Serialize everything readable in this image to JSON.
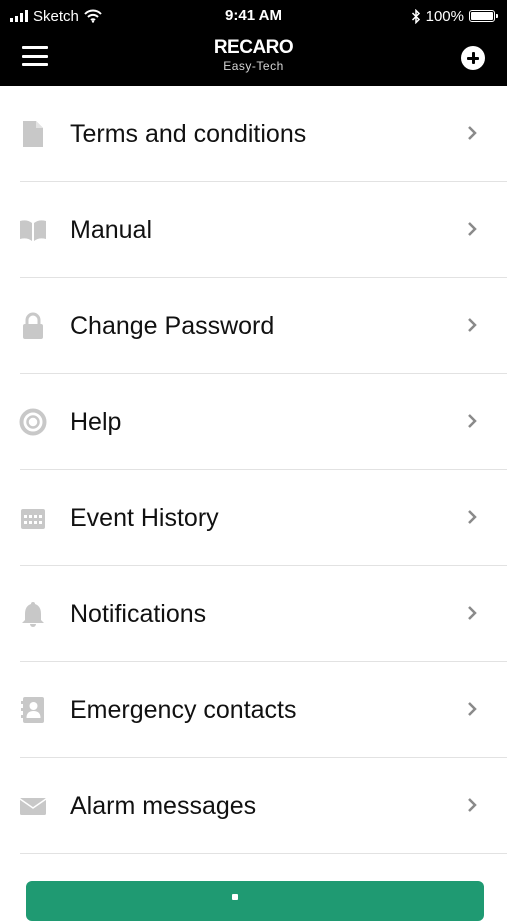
{
  "status_bar": {
    "carrier": "Sketch",
    "time": "9:41 AM",
    "battery_text": "100%",
    "battery_level": 1.0,
    "icons": [
      "signal-icon",
      "wifi-icon",
      "bluetooth-icon",
      "battery-icon"
    ]
  },
  "header": {
    "logo": "RECARO",
    "subtitle": "Easy-Tech",
    "menu_icon": "hamburger-menu-icon",
    "add_icon": "plus-circle-icon"
  },
  "menu": {
    "items": [
      {
        "label": "Terms and conditions",
        "icon": "document-icon"
      },
      {
        "label": "Manual",
        "icon": "book-icon"
      },
      {
        "label": "Change Password",
        "icon": "lock-icon"
      },
      {
        "label": "Help",
        "icon": "lifebuoy-icon"
      },
      {
        "label": "Event History",
        "icon": "calendar-icon"
      },
      {
        "label": "Notifications",
        "icon": "bell-icon"
      },
      {
        "label": "Emergency contacts",
        "icon": "contact-card-icon"
      },
      {
        "label": "Alarm messages",
        "icon": "envelope-icon"
      }
    ]
  },
  "colors": {
    "header_bg": "#000000",
    "icon_gray": "#c8c8c8",
    "chevron_gray": "#8a8a8a",
    "divider": "#e2e2e2",
    "accent_green": "#1f9a72"
  }
}
